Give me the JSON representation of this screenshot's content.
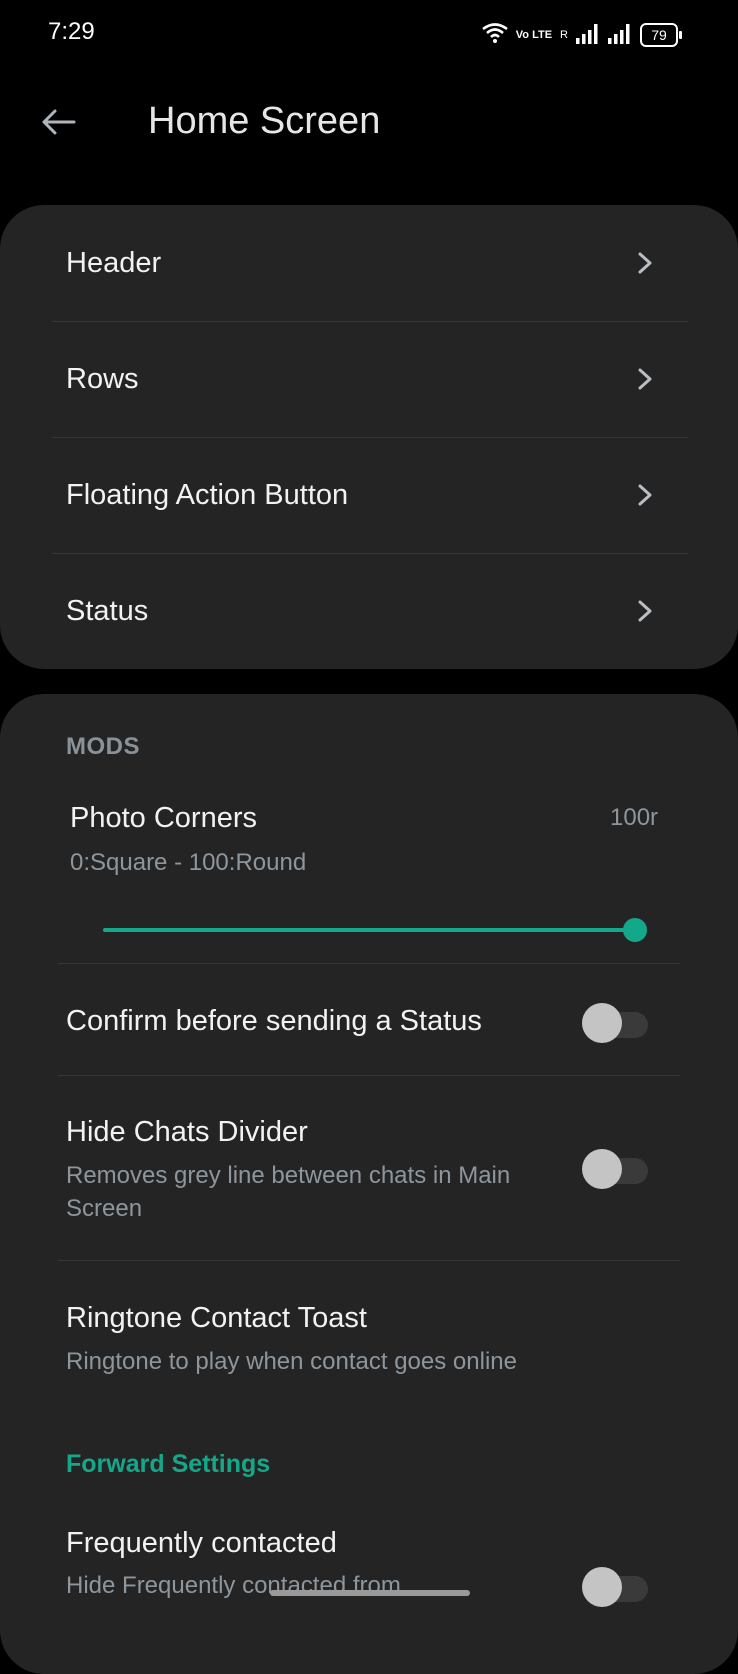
{
  "status_bar": {
    "time": "7:29",
    "battery": "79",
    "network_label": "Vo LTE",
    "roaming": "R"
  },
  "header": {
    "title": "Home Screen",
    "back_icon": "arrow-left-icon"
  },
  "nav_card": {
    "items": [
      {
        "label": "Header"
      },
      {
        "label": "Rows"
      },
      {
        "label": "Floating Action Button"
      },
      {
        "label": "Status"
      }
    ]
  },
  "mods": {
    "section_title": "MODS",
    "photo_corners": {
      "title": "Photo Corners",
      "subtitle": "0:Square - 100:Round",
      "value_label": "100r",
      "value": 100,
      "min": 0,
      "max": 100
    },
    "confirm_status": {
      "title": "Confirm before sending a Status",
      "enabled": false
    },
    "hide_divider": {
      "title": "Hide Chats Divider",
      "subtitle": "Removes grey line between chats in Main Screen",
      "enabled": false
    },
    "ringtone_toast": {
      "title": "Ringtone Contact Toast",
      "subtitle": "Ringtone to play when contact goes online"
    }
  },
  "forward": {
    "section_title": "Forward Settings",
    "frequently_contacted": {
      "title": "Frequently contacted",
      "subtitle": "Hide Frequently contacted from",
      "enabled": false
    }
  },
  "colors": {
    "accent": "#14a88a",
    "card_bg": "#242424",
    "page_bg": "#000000"
  }
}
